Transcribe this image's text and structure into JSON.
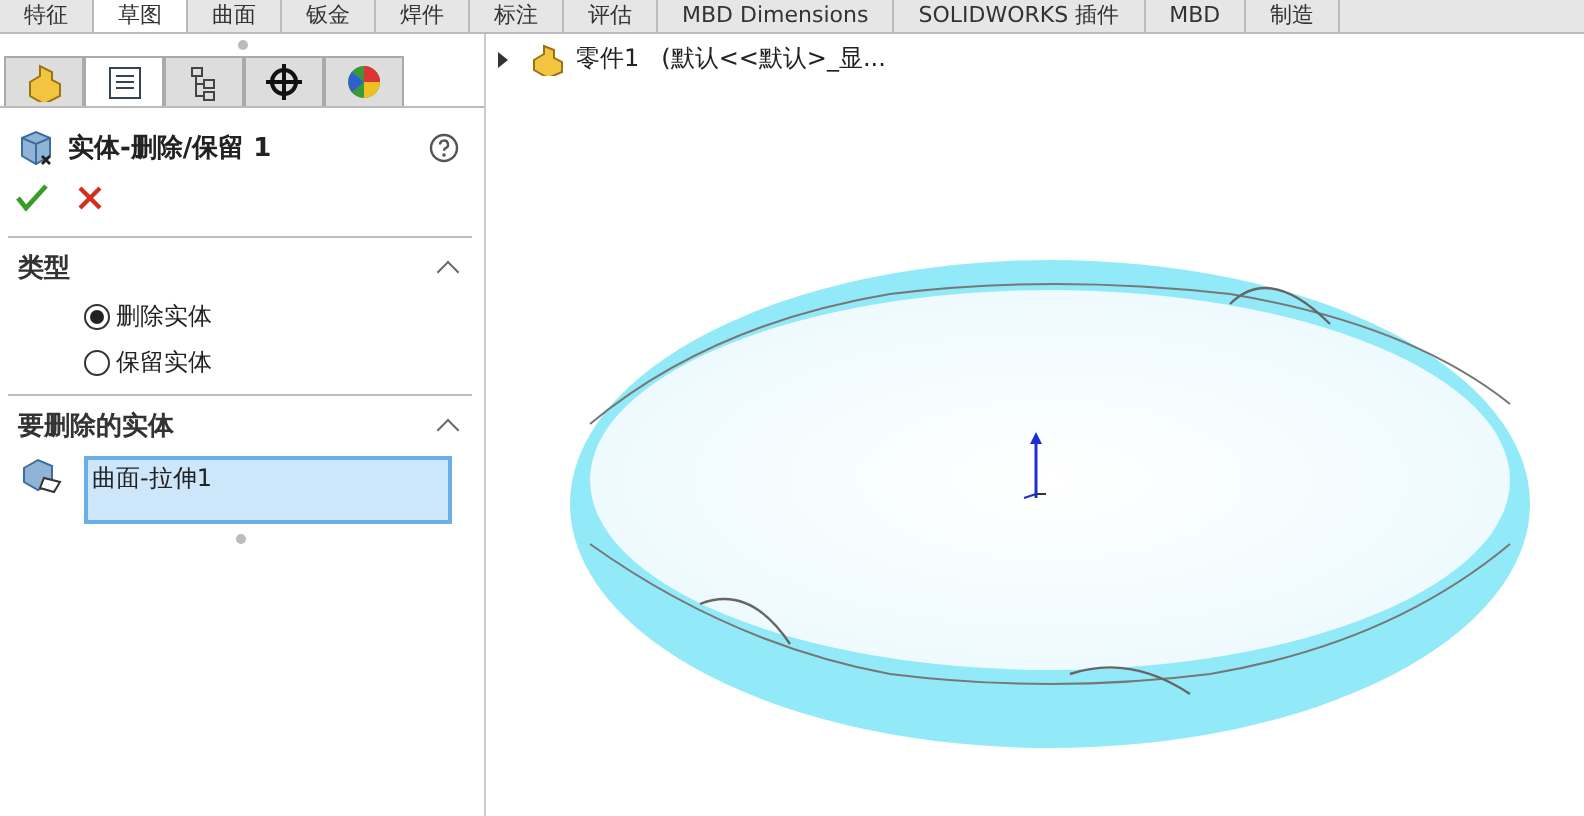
{
  "ribbon_tabs": [
    {
      "label": "特征",
      "selected": false
    },
    {
      "label": "草图",
      "selected": true
    },
    {
      "label": "曲面",
      "selected": false
    },
    {
      "label": "钣金",
      "selected": false
    },
    {
      "label": "焊件",
      "selected": false
    },
    {
      "label": "标注",
      "selected": false
    },
    {
      "label": "评估",
      "selected": false
    },
    {
      "label": "MBD Dimensions",
      "selected": false
    },
    {
      "label": "SOLIDWORKS 插件",
      "selected": false
    },
    {
      "label": "MBD",
      "selected": false
    },
    {
      "label": "制造",
      "selected": false
    }
  ],
  "manager_tabs": [
    {
      "kind": "feature",
      "selected": false
    },
    {
      "kind": "property",
      "selected": true
    },
    {
      "kind": "config",
      "selected": false
    },
    {
      "kind": "dimxpert",
      "selected": false
    },
    {
      "kind": "display",
      "selected": false
    }
  ],
  "property_manager": {
    "title": "实体-删除/保留 1",
    "sections": [
      {
        "kind": "radio",
        "title": "类型",
        "expanded": true,
        "options": [
          {
            "label": "删除实体",
            "selected": true
          },
          {
            "label": "保留实体",
            "selected": false
          }
        ]
      },
      {
        "kind": "list",
        "title": "要删除的实体",
        "expanded": true,
        "items": [
          "曲面-拉伸1"
        ]
      }
    ]
  },
  "tree": {
    "label": "零件1",
    "config": "(默认<<默认>_显..."
  }
}
